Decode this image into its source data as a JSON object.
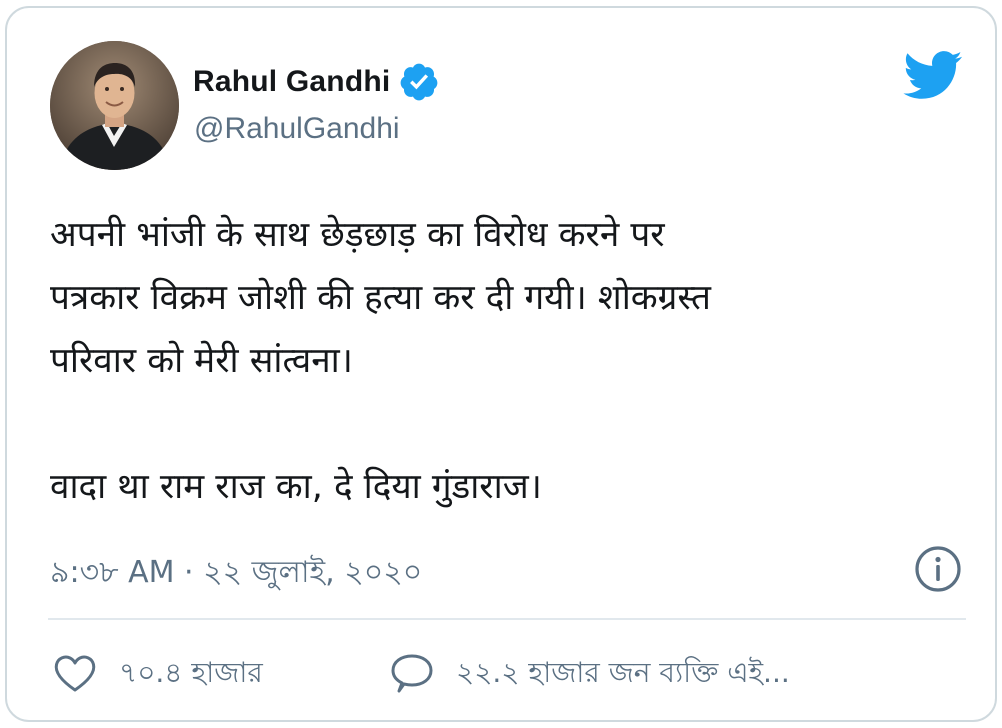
{
  "author": {
    "name": "Rahul Gandhi",
    "handle": "@RahulGandhi",
    "verified": true
  },
  "tweet": {
    "lines": [
      "अपनी भांजी के साथ छेड़छाड़ का विरोध करने पर",
      "पत्रकार विक्रम जोशी की हत्या कर दी गयी। शोकग्रस्त",
      "परिवार को मेरी सांत्वना।",
      "वादा था राम राज का, दे दिया गुंडाराज।"
    ],
    "timestamp": "৯:৩৮ AM · ২২ জুলাই, ২০২০"
  },
  "actions": {
    "likes": "৭০.৪ হাজার",
    "replies": "২২.২ হাজার জন ব্যক্তি এই..."
  },
  "icons": {
    "brand": "twitter-bird-icon",
    "verified": "verified-badge-icon",
    "info": "info-icon",
    "like": "heart-icon",
    "reply": "speech-bubble-icon"
  },
  "colors": {
    "twitter_blue": "#1da1f2",
    "text": "#14171a",
    "secondary": "#5b7083",
    "border": "#cfd9de"
  }
}
